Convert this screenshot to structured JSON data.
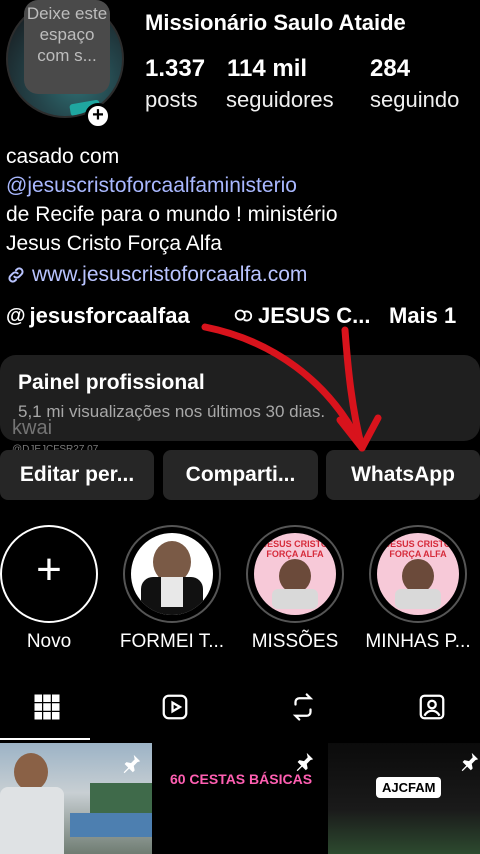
{
  "profile": {
    "name": "Missionário Saulo Ataide",
    "note_bubble": "Deixe este espaço com s...",
    "stats": [
      {
        "value": "1.337",
        "label": "posts"
      },
      {
        "value": "114 mil",
        "label": "seguidores"
      },
      {
        "value": "284",
        "label": "seguindo"
      }
    ]
  },
  "bio": {
    "line1": "casado com",
    "mention": "@jesuscristoforcaalfaministerio",
    "line3": "de Recife para o mundo ! ministério",
    "line4": "Jesus Cristo Força Alfa",
    "link": "www.jesuscristoforcaalfa.com"
  },
  "threads": {
    "handle": "jesusforcaalfaa",
    "channel": "JESUS C...",
    "more": "Mais 1"
  },
  "panel": {
    "title": "Painel profissional",
    "subtitle": "5,1 mi visualizações nos últimos 30 dias."
  },
  "watermark": {
    "brand": "kwai",
    "id": "@DJEJCFSR27.07"
  },
  "buttons": {
    "edit": "Editar per...",
    "share": "Comparti...",
    "whatsapp": "WhatsApp"
  },
  "highlights": [
    {
      "label": "Novo"
    },
    {
      "label": "FORMEI T..."
    },
    {
      "label": "MISSÕES"
    },
    {
      "label": "MINHAS P..."
    }
  ],
  "highlight_cover_text": "JESUS CRISTO FORÇA ALFA",
  "tabs": [
    "grid-icon",
    "reels-icon",
    "reposts-icon",
    "tagged-icon"
  ],
  "posts": [
    {
      "overlay": ""
    },
    {
      "overlay": "60 CESTAS BÁSICAS"
    },
    {
      "overlay": "AJCFAM"
    }
  ],
  "colors": {
    "background": "#000000",
    "surface": "#262626",
    "link": "#a9b8ff",
    "arrow": "#d8131c"
  }
}
